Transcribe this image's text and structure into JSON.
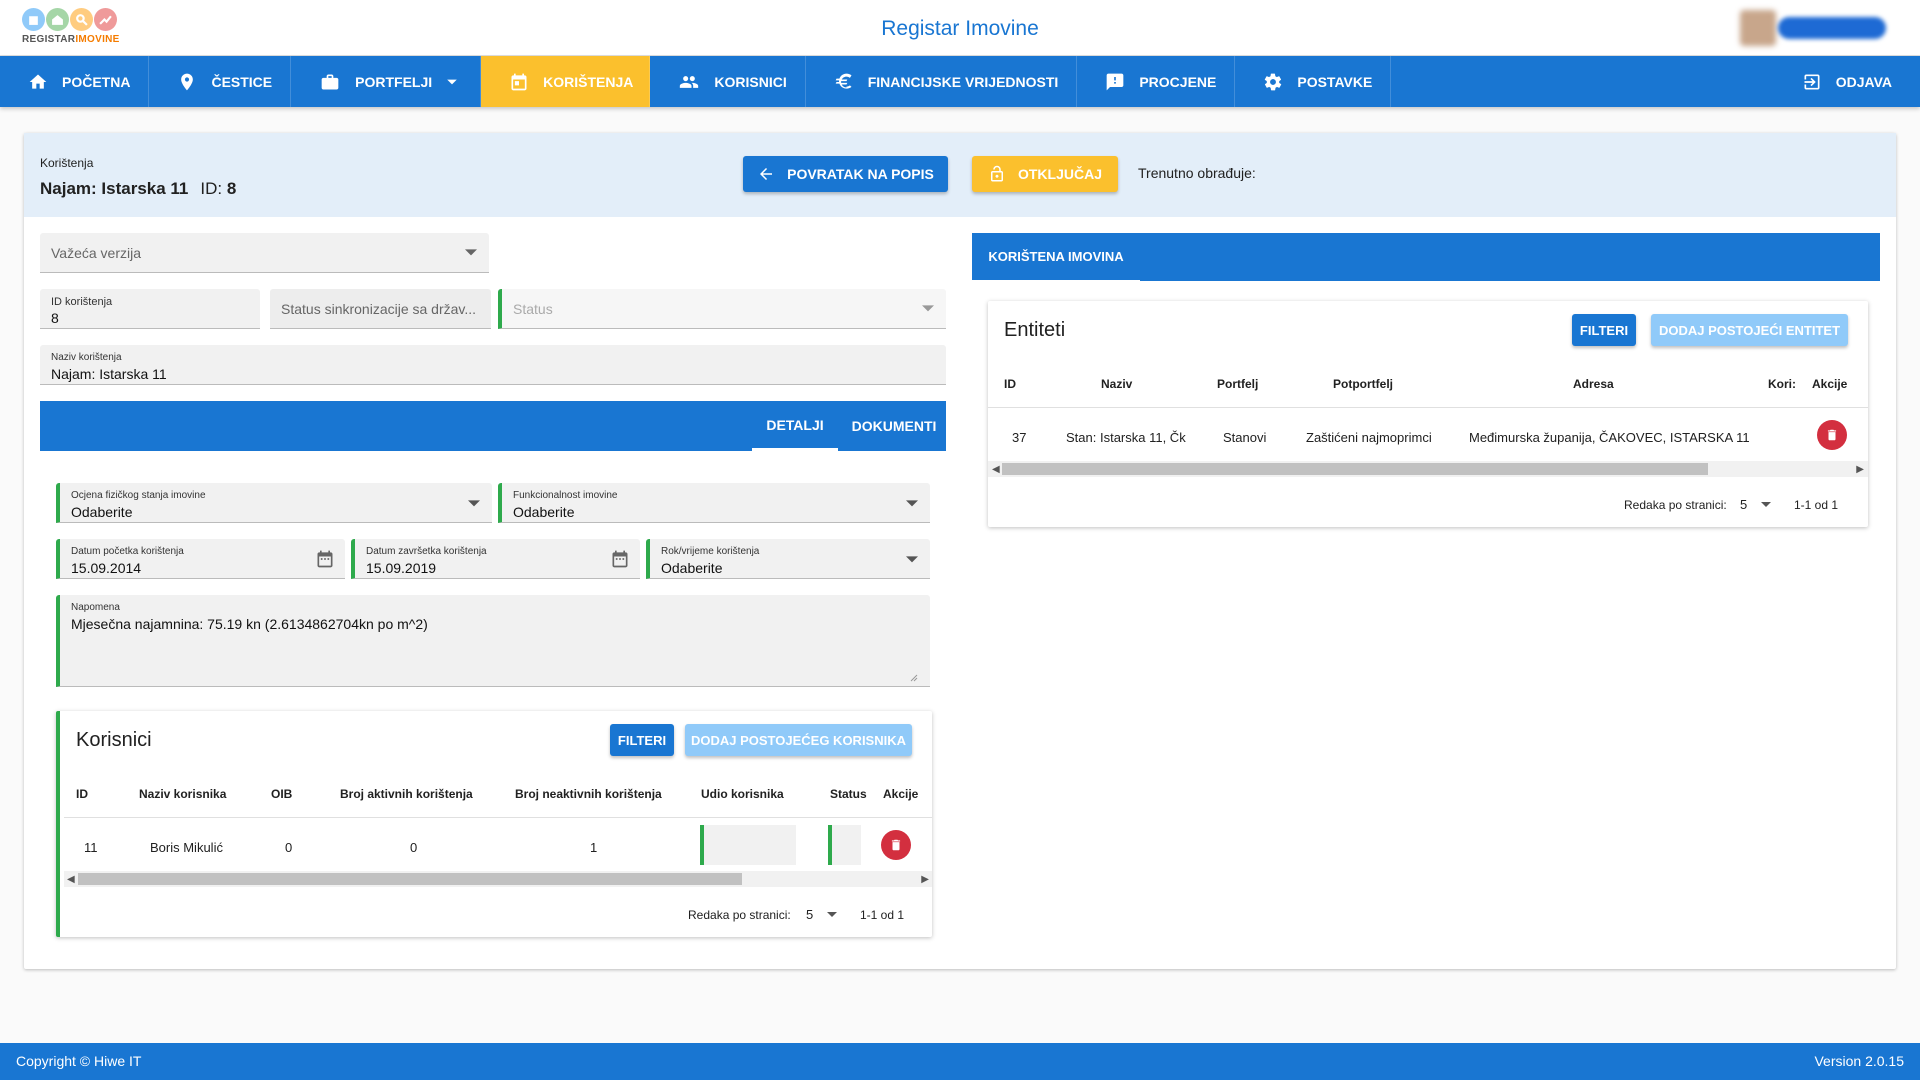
{
  "header": {
    "logo_text_a": "REGISTAR",
    "logo_text_b": "IMOVINE",
    "app_title": "Registar Imovine"
  },
  "nav": {
    "items": [
      {
        "label": "POČETNA",
        "icon": "home-icon"
      },
      {
        "label": "ČESTICE",
        "icon": "map-pin-icon"
      },
      {
        "label": "PORTFELJI",
        "icon": "briefcase-icon"
      },
      {
        "label": "KORIŠTENJA",
        "icon": "calendar-icon"
      },
      {
        "label": "KORISNICI",
        "icon": "people-icon"
      },
      {
        "label": "FINANCIJSKE VRIJEDNOSTI",
        "icon": "euro-icon"
      },
      {
        "label": "PROCJENE",
        "icon": "feedback-icon"
      },
      {
        "label": "POSTAVKE",
        "icon": "gear-icon"
      }
    ],
    "active_index": 3,
    "logout": "ODJAVA"
  },
  "record": {
    "crumb": "Korištenja",
    "title": "Najam: Istarska 11",
    "id_label": "ID:",
    "id_value": "8",
    "back_button": "POVRATAK NA POPIS",
    "unlock_button": "OTKLJUČAJ",
    "editing_label": "Trenutno obrađuje:"
  },
  "form": {
    "version_placeholder": "Važeća verzija",
    "id_label": "ID korištenja",
    "id_value": "8",
    "sync_placeholder": "Status sinkronizacije sa držav...",
    "status_placeholder": "Status",
    "name_label": "Naziv korištenja",
    "name_value": "Najam: Istarska 11",
    "tabs": [
      "DETALJI",
      "DOKUMENTI"
    ],
    "condition_label": "Ocjena fizičkog stanja imovine",
    "condition_value": "Odaberite",
    "function_label": "Funkcionalnost imovine",
    "function_value": "Odaberite",
    "start_label": "Datum početka korištenja",
    "start_value": "15.09.2014",
    "end_label": "Datum završetka korištenja",
    "end_value": "15.09.2019",
    "term_label": "Rok/vrijeme korištenja",
    "term_value": "Odaberite",
    "note_label": "Napomena",
    "note_value": "Mjesečna najamnina: 75.19 kn (2.6134862704kn po m^2)"
  },
  "users": {
    "title": "Korisnici",
    "filter_button": "FILTERI",
    "add_button": "DODAJ POSTOJEĆEG KORISNIKA",
    "columns": [
      "ID",
      "Naziv korisnika",
      "OIB",
      "Broj aktivnih korištenja",
      "Broj neaktivnih korištenja",
      "Udio korisnika",
      "Status",
      "Akcije"
    ],
    "rows": [
      {
        "id": "11",
        "name": "Boris Mikulić",
        "oib": "0",
        "active": "0",
        "inactive": "1"
      }
    ],
    "rows_per_page_label": "Redaka po stranici:",
    "rows_per_page": "5",
    "range": "1-1 od 1"
  },
  "assets": {
    "tab": "KORIŠTENA IMOVINA",
    "title": "Entiteti",
    "filter_button": "FILTERI",
    "add_button": "DODAJ POSTOJEĆI ENTITET",
    "columns": [
      "ID",
      "Naziv",
      "Portfelj",
      "Potportfelj",
      "Adresa",
      "Kori:",
      "Akcije"
    ],
    "rows": [
      {
        "id": "37",
        "name": "Stan: Istarska 11, Čk",
        "portfolio": "Stanovi",
        "subportfolio": "Zaštićeni najmoprimci",
        "address": "Međimurska županija, ČAKOVEC, ISTARSKA 11"
      }
    ],
    "rows_per_page_label": "Redaka po stranici:",
    "rows_per_page": "5",
    "range": "1-1 od 1"
  },
  "footer": {
    "copyright": "Copyright © Hiwe IT",
    "version": "Version 2.0.15"
  }
}
